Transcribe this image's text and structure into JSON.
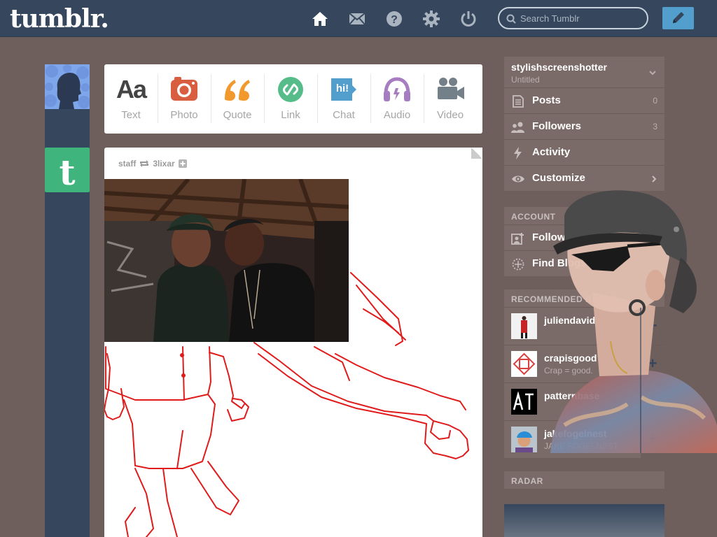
{
  "header": {
    "logo": "tumblr.",
    "search_placeholder": "Search Tumblr"
  },
  "post_types": [
    {
      "id": "text",
      "label": "Text",
      "glyph": "Aa",
      "color": "#444444"
    },
    {
      "id": "photo",
      "label": "Photo",
      "color": "#d95e40"
    },
    {
      "id": "quote",
      "label": "Quote",
      "color": "#f2992e"
    },
    {
      "id": "link",
      "label": "Link",
      "color": "#56bc8a"
    },
    {
      "id": "chat",
      "label": "Chat",
      "glyph": "hi!",
      "color": "#529ecc"
    },
    {
      "id": "audio",
      "label": "Audio",
      "color": "#a77dc2"
    },
    {
      "id": "video",
      "label": "Video",
      "color": "#748089"
    }
  ],
  "post": {
    "author": "staff",
    "reblogged_from": "3lixar"
  },
  "sidebar": {
    "blog_name": "stylishscreenshotter",
    "blog_subtitle": "Untitled",
    "items": [
      {
        "label": "Posts",
        "count": "0"
      },
      {
        "label": "Followers",
        "count": "3"
      },
      {
        "label": "Activity",
        "count": ""
      },
      {
        "label": "Customize",
        "count": ""
      }
    ],
    "account_title": "ACCOUNT",
    "account_items": [
      {
        "label": "Following 2 blogs"
      },
      {
        "label": "Find Blogs"
      }
    ],
    "recommended_title": "RECOMMENDED BLOGS",
    "recommended": [
      {
        "name": "juliendavid",
        "sub": ""
      },
      {
        "name": "crapisgood",
        "sub": "Crap = good."
      },
      {
        "name": "patternbase",
        "sub": ""
      },
      {
        "name": "jakefogelnest",
        "sub": "JAKE FOGELNEST"
      }
    ],
    "radar_title": "RADAR"
  },
  "colors": {
    "header_bg": "#36465d",
    "page_bg": "#6f5f5c",
    "sidebar_bg": "#7b6b68",
    "compose_button": "#529ecc",
    "drawing_stroke": "#e01b1b"
  }
}
